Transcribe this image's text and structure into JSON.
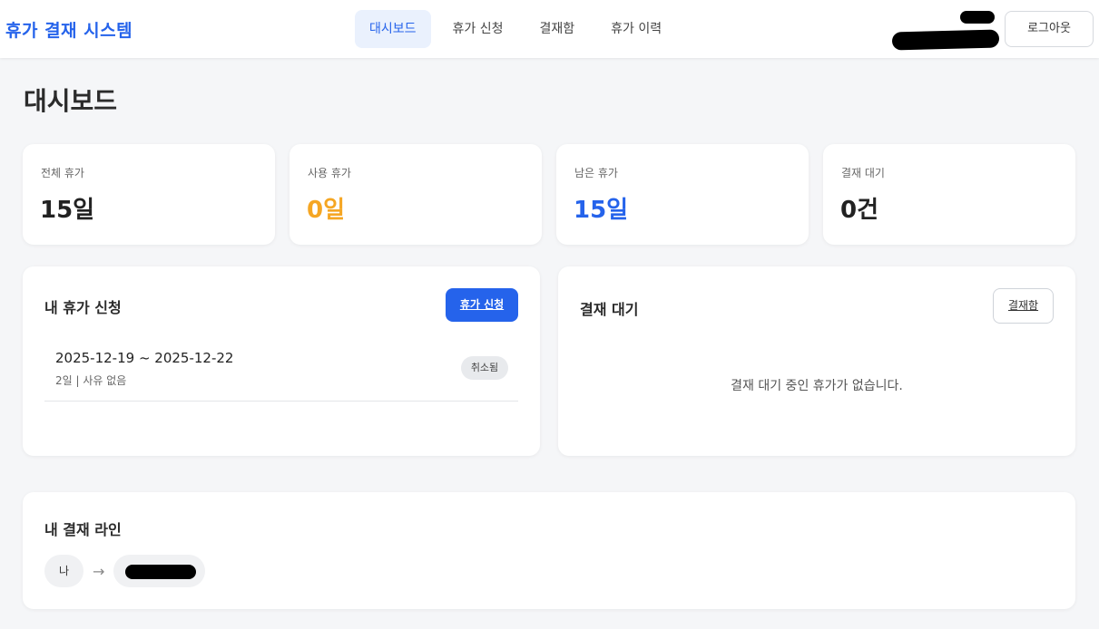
{
  "header": {
    "brand": "휴가 결재 시스템",
    "nav": [
      "대시보드",
      "휴가 신청",
      "결재함",
      "휴가 이력"
    ],
    "active_nav": "대시보드",
    "logout_label": "로그아웃"
  },
  "page": {
    "title": "대시보드"
  },
  "stats": [
    {
      "label": "전체 휴가",
      "value": "15일",
      "color": "#222222"
    },
    {
      "label": "사용 휴가",
      "value": "0일",
      "color": "#f5a623"
    },
    {
      "label": "남은 휴가",
      "value": "15일",
      "color": "#2563eb"
    },
    {
      "label": "결재 대기",
      "value": "0건",
      "color": "#222222"
    }
  ],
  "my_requests": {
    "title": "내 휴가 신청",
    "new_button": "휴가 신청",
    "items": [
      {
        "dates": "2025-12-19 ~ 2025-12-22",
        "meta": "2일 | 사유 없음",
        "status": "취소됨"
      }
    ]
  },
  "pending": {
    "title": "결재 대기",
    "button": "결재함",
    "empty": "결재 대기 중인 휴가가 없습니다."
  },
  "approval_line": {
    "title": "내 결재 라인",
    "self_label": "나",
    "arrow": "→"
  },
  "colors": {
    "accent": "#2563eb",
    "warning": "#f5a623"
  }
}
